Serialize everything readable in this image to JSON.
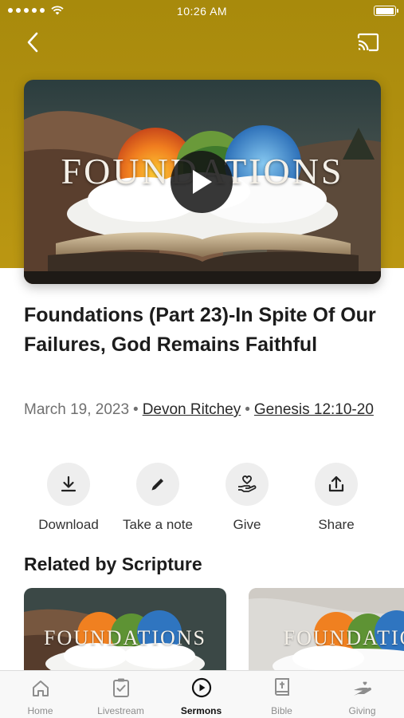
{
  "status_bar": {
    "time": "10:26 AM"
  },
  "nav": {
    "back_icon": "chevron-left-icon",
    "cast_icon": "cast-icon"
  },
  "video": {
    "series_title": "FOUNDATIONS",
    "play_icon": "play-icon"
  },
  "sermon": {
    "title": "Foundations (Part 23)-In Spite Of Our Failures, God Remains Faithful",
    "date": "March 19, 2023",
    "separator": "•",
    "speaker": "Devon Ritchey",
    "scripture": "Genesis 12:10-20"
  },
  "actions": [
    {
      "label": "Download",
      "icon": "download-icon"
    },
    {
      "label": "Take a note",
      "icon": "pencil-icon"
    },
    {
      "label": "Give",
      "icon": "give-heart-hand-icon"
    },
    {
      "label": "Share",
      "icon": "share-icon"
    }
  ],
  "related": {
    "title": "Related by Scripture",
    "items": [
      {
        "series_title": "FOUNDATIONS"
      },
      {
        "series_title": "FOUNDATIO"
      }
    ]
  },
  "tabs": [
    {
      "label": "Home",
      "icon": "home-icon"
    },
    {
      "label": "Livestream",
      "icon": "livestream-icon"
    },
    {
      "label": "Sermons",
      "icon": "sermons-play-icon",
      "active": true
    },
    {
      "label": "Bible",
      "icon": "bible-icon"
    },
    {
      "label": "Giving",
      "icon": "giving-icon"
    }
  ],
  "colors": {
    "header_gold": "#b08f0f",
    "tab_active": "#111111",
    "tab_inactive": "#8d8d8d"
  }
}
